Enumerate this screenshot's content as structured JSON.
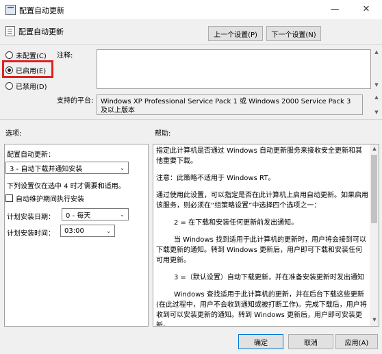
{
  "window": {
    "title": "配置自动更新",
    "minimize_glyph": "—",
    "close_glyph": "✕"
  },
  "header": {
    "title": "配置自动更新",
    "prev_button": "上一个设置(P)",
    "next_button": "下一个设置(N)"
  },
  "radios": [
    {
      "label": "未配置(C)",
      "selected": false
    },
    {
      "label": "已启用(E)",
      "selected": true
    },
    {
      "label": "已禁用(D)",
      "selected": false
    }
  ],
  "highlight_color": "#e02020",
  "comment": {
    "label": "注释:",
    "value": ""
  },
  "platform": {
    "label": "支持的平台:",
    "value": "Windows XP Professional Service Pack 1 或 Windows 2000 Service Pack 3 及以上版本"
  },
  "options": {
    "section_label": "选项:",
    "config_label": "配置自动更新：",
    "config_value": "3 - 自动下载并通知安装",
    "note": "下列设置仅在选中 4 时才需要和适用。",
    "maintenance_label": "自动维护期间执行安装",
    "maintenance_checked": false,
    "day_label": "计划安装日期：",
    "day_value": "0 - 每天",
    "time_label": "计划安装时间：",
    "time_value": "03:00"
  },
  "help": {
    "section_label": "帮助:",
    "paragraphs": [
      "指定此计算机是否通过 Windows 自动更新服务来接收安全更新和其他重要下载。",
      "注意：此策略不适用于 Windows RT。",
      "通过使用此设置，可以指定是否在此计算机上启用自动更新。如果启用该服务，则必须在“组策略设置”中选择四个选项之一：",
      "2 = 在下载和安装任何更新前发出通知。",
      "当 Windows 找到适用于此计算机的更新时，用户将会接到可以下载更新的通知。转到 Windows 更新后，用户即可下载和安装任何可用更新。",
      "3 =（默认设置）自动下载更新，并在准备安装更新时发出通知",
      "Windows 查找适用于此计算机的更新，并在后台下载这些更新(在此过程中，用户不会收到通知或被打断工作)。完成下载后，用户将收到可以安装更新的通知。转到 Windows 更新后，用户即可安装更新。"
    ]
  },
  "footer": {
    "ok": "确定",
    "cancel": "取消",
    "apply": "应用(A)"
  }
}
